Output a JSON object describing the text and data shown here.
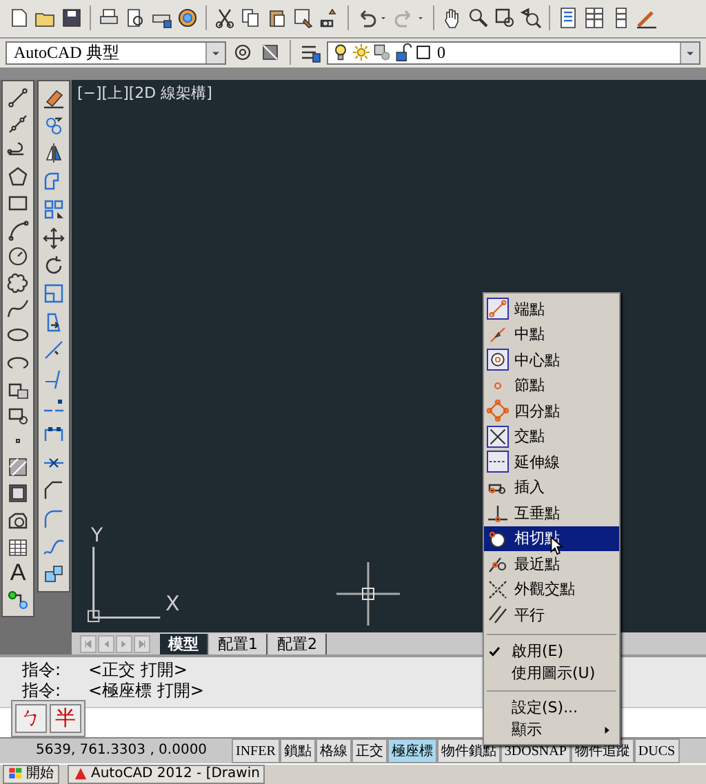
{
  "toolbar": {
    "workspace": "AutoCAD 典型",
    "layer": "0"
  },
  "viewport_label": "[−][上][2D 線架構]",
  "ucs": {
    "y_label": "Y",
    "x_label": "X"
  },
  "draw_tools": {
    "text_glyph": "A"
  },
  "layout_tabs": [
    {
      "label": "模型",
      "selected": true
    },
    {
      "label": "配置1",
      "selected": false
    },
    {
      "label": "配置2",
      "selected": false
    }
  ],
  "command_lines": [
    {
      "prompt": "指令:",
      "message": "<正交  打開>"
    },
    {
      "prompt": "指令:",
      "message": "<極座標  打開>"
    }
  ],
  "ime": [
    "ㄅ",
    "半"
  ],
  "coordinates": "5639, 761.3303 , 0.0000",
  "status_buttons": [
    {
      "label": "INFER",
      "on": false
    },
    {
      "label": "鎖點",
      "on": false
    },
    {
      "label": "格線",
      "on": false
    },
    {
      "label": "正交",
      "on": false
    },
    {
      "label": "極座標",
      "on": true
    },
    {
      "label": "物件鎖點",
      "on": false
    },
    {
      "label": "3DOSNAP",
      "on": false
    },
    {
      "label": "物件追蹤",
      "on": false
    },
    {
      "label": "DUCS",
      "on": false
    }
  ],
  "osnap_menu": {
    "snaps": [
      {
        "label": "端點",
        "selected": false
      },
      {
        "label": "中點",
        "selected": false
      },
      {
        "label": "中心點",
        "selected": false
      },
      {
        "label": "節點",
        "selected": false
      },
      {
        "label": "四分點",
        "selected": false
      },
      {
        "label": "交點",
        "selected": false
      },
      {
        "label": "延伸線",
        "selected": false
      },
      {
        "label": "插入",
        "selected": false
      },
      {
        "label": "互垂點",
        "selected": false
      },
      {
        "label": "相切點",
        "selected": true
      },
      {
        "label": "最近點",
        "selected": false
      },
      {
        "label": "外觀交點",
        "selected": false
      },
      {
        "label": "平行",
        "selected": false
      }
    ],
    "options": [
      {
        "label": "啟用(E)",
        "checked": true
      },
      {
        "label": "使用圖示(U)",
        "checked": false
      }
    ],
    "commands": [
      {
        "label": "設定(S)...",
        "submenu": false
      },
      {
        "label": "顯示",
        "submenu": true
      }
    ]
  },
  "taskbar": {
    "start": "開始",
    "window": "AutoCAD 2012 - [Drawin"
  }
}
